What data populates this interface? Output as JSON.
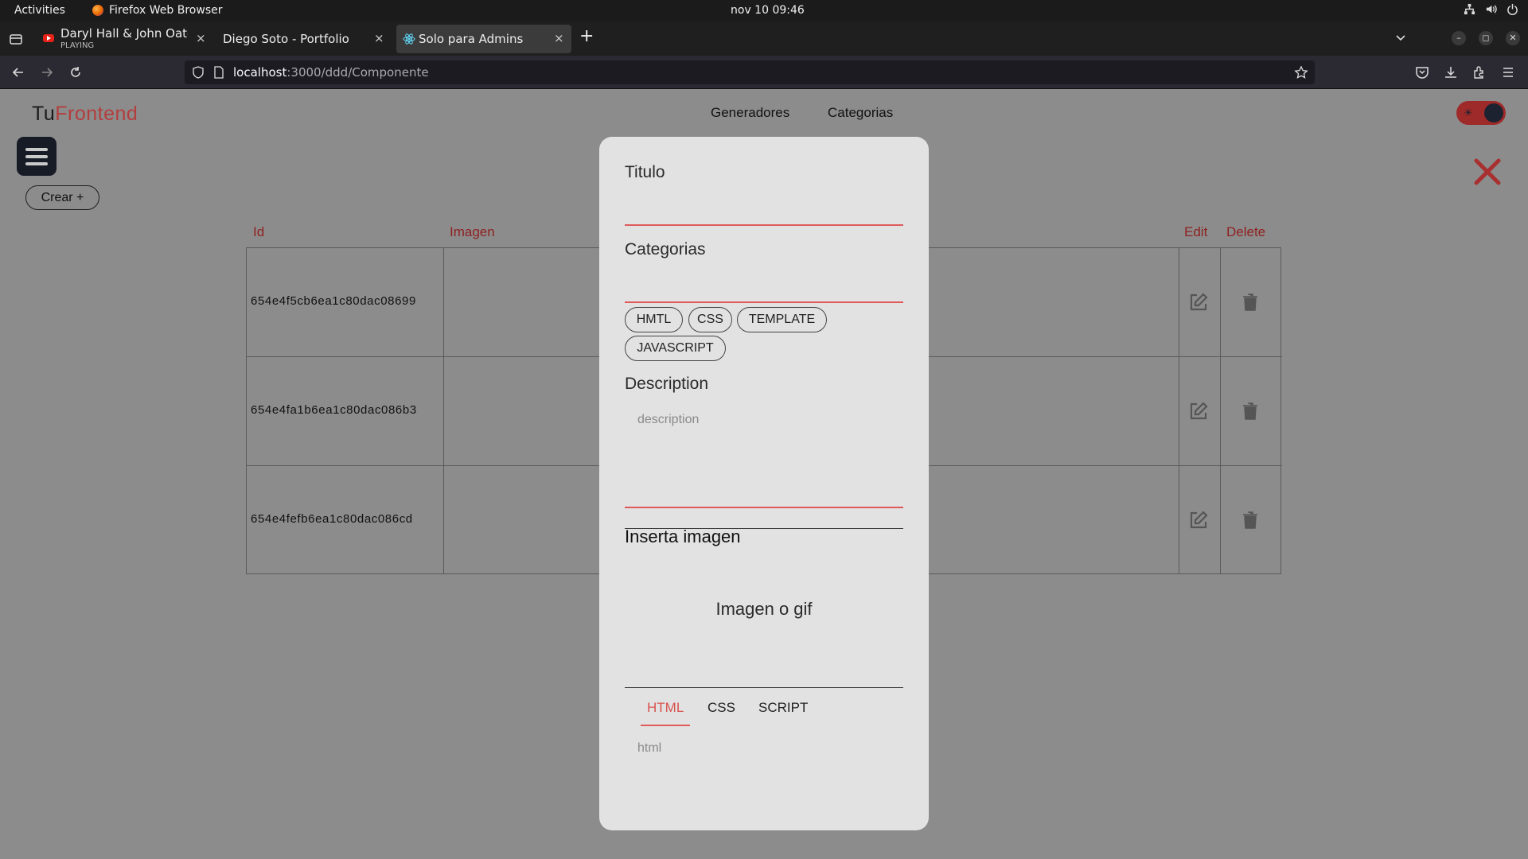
{
  "system": {
    "activities": "Activities",
    "app_name": "Firefox Web Browser",
    "clock": "nov 10  09:46"
  },
  "browser": {
    "tabs": [
      {
        "title": "Daryl Hall & John Oates -",
        "subtitle": "PLAYING",
        "favicon": "youtube-icon",
        "active": false
      },
      {
        "title": "Diego Soto - Portfolio",
        "subtitle": "",
        "favicon": "",
        "active": false
      },
      {
        "title": "Solo para Admins",
        "subtitle": "",
        "favicon": "react-icon",
        "active": true
      }
    ],
    "close_glyph": "×",
    "new_tab_glyph": "+",
    "url_host": "localhost",
    "url_path": ":3000/ddd/Componente",
    "window_buttons": [
      "–",
      "◻",
      "✕"
    ]
  },
  "page": {
    "logo_main": "Tu",
    "logo_accent": "Frontend",
    "nav": [
      "Generadores",
      "Categorias"
    ],
    "crear_button": "Crear +",
    "theme_toggle_icon": "☀",
    "accent_color": "#e05a5a",
    "table": {
      "headers": {
        "id": "Id",
        "image": "Imagen",
        "edit": "Edit",
        "delete": "Delete"
      },
      "rows": [
        {
          "id": "654e4f5cb6ea1c80dac08699"
        },
        {
          "id": "654e4fa1b6ea1c80dac086b3"
        },
        {
          "id": "654e4fefb6ea1c80dac086cd"
        }
      ]
    }
  },
  "modal": {
    "titulo_label": "Titulo",
    "categorias_label": "Categorias",
    "categories": [
      "HMTL",
      "CSS",
      "TEMPLATE",
      "JAVASCRIPT"
    ],
    "description_label": "Description",
    "description_placeholder": "description",
    "image_heading": "Inserta imagen",
    "image_drop_text": "Imagen o gif",
    "code_tabs": [
      "HTML",
      "CSS",
      "SCRIPT"
    ],
    "active_code_tab": "HTML",
    "code_placeholder": "html"
  }
}
